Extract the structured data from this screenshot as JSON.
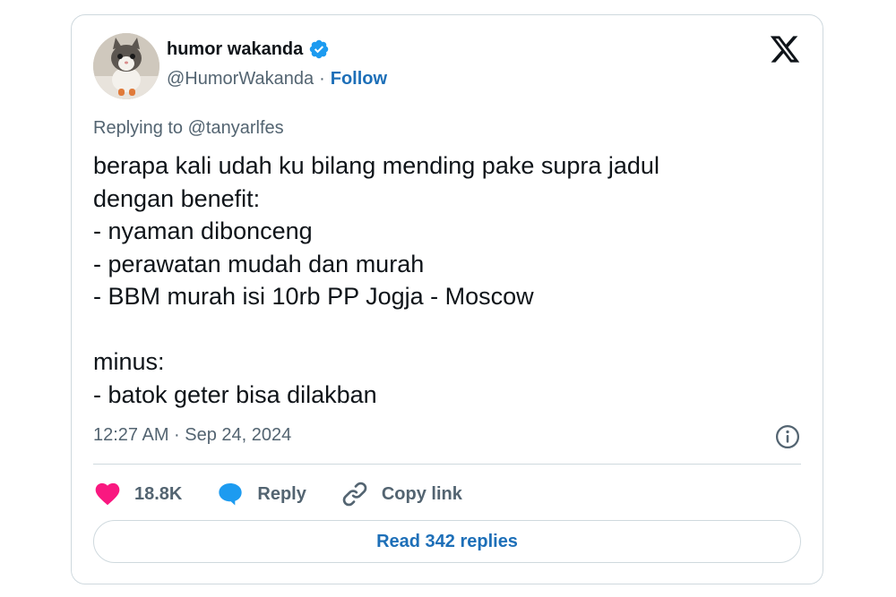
{
  "author": {
    "display_name": "humor wakanda",
    "handle": "@HumorWakanda",
    "separator": "·",
    "follow_label": "Follow",
    "verified_color": "#1d9bf0"
  },
  "reply_context": {
    "prefix": "Replying to",
    "mention": "@tanyarlfes"
  },
  "tweet": {
    "lines": [
      "berapa kali udah ku bilang mending pake supra jadul",
      "dengan benefit:",
      "- nyaman dibonceng",
      "- perawatan mudah dan murah",
      "- BBM murah isi 10rb PP Jogja - Moscow",
      "",
      "minus:",
      "- batok geter bisa dilakban"
    ],
    "timestamp": "12:27 AM · Sep 24, 2024"
  },
  "actions": {
    "like_count": "18.8K",
    "reply_label": "Reply",
    "copy_link_label": "Copy link",
    "like_color": "#f91880",
    "reply_color": "#1d9bf0"
  },
  "footer": {
    "read_replies_label": "Read 342 replies"
  },
  "icons": {
    "logo": "x-logo-icon",
    "info": "info-icon",
    "like": "heart-icon",
    "reply": "speech-bubble-icon",
    "copy": "link-icon",
    "verified": "verified-badge-icon"
  }
}
